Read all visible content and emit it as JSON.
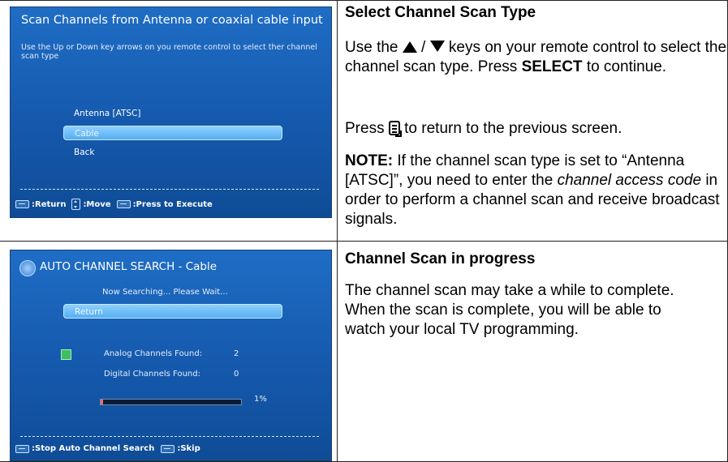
{
  "screen1": {
    "title": "Scan Channels from Antenna or coaxial cable input",
    "instruction": "Use the Up or Down key arrows on you remote control to select ther channel scan type",
    "menu": [
      {
        "label": "Antenna [ATSC]"
      },
      {
        "label": "Cable"
      },
      {
        "label": "Back"
      }
    ],
    "footer": {
      "return_label": ":Return",
      "move_label": ":Move",
      "execute_label": ":Press to Execute"
    }
  },
  "screen2": {
    "title": "AUTO CHANNEL SEARCH - Cable",
    "status": "Now Searching... Please Wait...",
    "return_label": "Return",
    "analog_label": "Analog Channels Found:",
    "analog_value": "2",
    "digital_label": "Digital Channels Found:",
    "digital_value": "0",
    "progress": 0.01,
    "progress_label": "1%",
    "footer": {
      "stop_label": ":Stop Auto Channel Search",
      "skip_label": ":Skip"
    }
  },
  "section1": {
    "heading": "Select Channel Scan Type",
    "p1_pre": "Use the",
    "p1_sep": "/",
    "p1_mid": "keys on your remote control to select the channel scan type. Press",
    "p1_bold": "SELECT",
    "p1_post": "to continue.",
    "p2_pre": "Press",
    "p2_post": "to return to the previous screen.",
    "note_label": "NOTE:",
    "note_a": "If the channel scan type is set to “Antenna [ATSC]”, you need to enter the",
    "note_italic": "channel access code",
    "note_b": "in order to perform a channel scan and receive broadcast signals."
  },
  "section2": {
    "heading": "Channel Scan in progress",
    "body": "The channel scan may take a while to complete. When the scan is complete, you will be able to watch your local TV programming."
  },
  "icons": [
    "up-triangle-icon",
    "down-triangle-icon",
    "menu-button-icon",
    "search-icon",
    "channel-grid-icon"
  ]
}
